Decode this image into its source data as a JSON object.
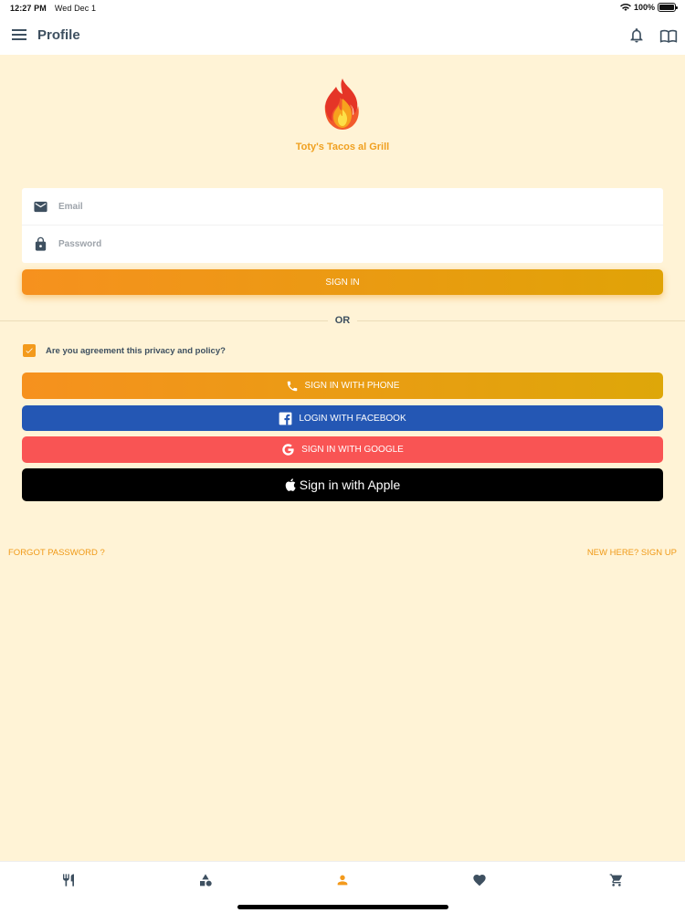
{
  "status_bar": {
    "time": "12:27 PM",
    "date": "Wed Dec 1",
    "battery": "100%",
    "icons": [
      "wifi-icon",
      "battery-icon"
    ]
  },
  "app_bar": {
    "title": "Profile",
    "icons": [
      "menu-icon",
      "bell-icon",
      "book-icon"
    ]
  },
  "brand": {
    "name": "Toty's Tacos al Grill",
    "logo_icon": "fire-logo"
  },
  "login": {
    "email_placeholder": "Email",
    "email_value": "",
    "password_placeholder": "Password",
    "password_value": "",
    "sign_in_label": "SIGN IN"
  },
  "divider": {
    "label": "OR"
  },
  "agreement": {
    "checked": true,
    "label": "Are you agreement this privacy and policy?"
  },
  "social": {
    "phone_label": "SIGN IN WITH PHONE",
    "facebook_label": "LOGIN WITH FACEBOOK",
    "google_label": "SIGN IN WITH GOOGLE",
    "apple_label": "Sign in with Apple"
  },
  "links": {
    "forgot": "FORGOT PASSWORD ?",
    "signup": "NEW HERE? SIGN UP"
  },
  "bottom_nav": {
    "items": [
      "utensils-icon",
      "categories-icon",
      "profile-icon",
      "heart-icon",
      "cart-icon"
    ],
    "active": "profile-icon"
  },
  "colors": {
    "background": "#fff3d6",
    "accent": "#f39a1c",
    "facebook": "#2457b4",
    "google": "#f95454",
    "apple": "#000000",
    "title_text": "#3e5060"
  }
}
